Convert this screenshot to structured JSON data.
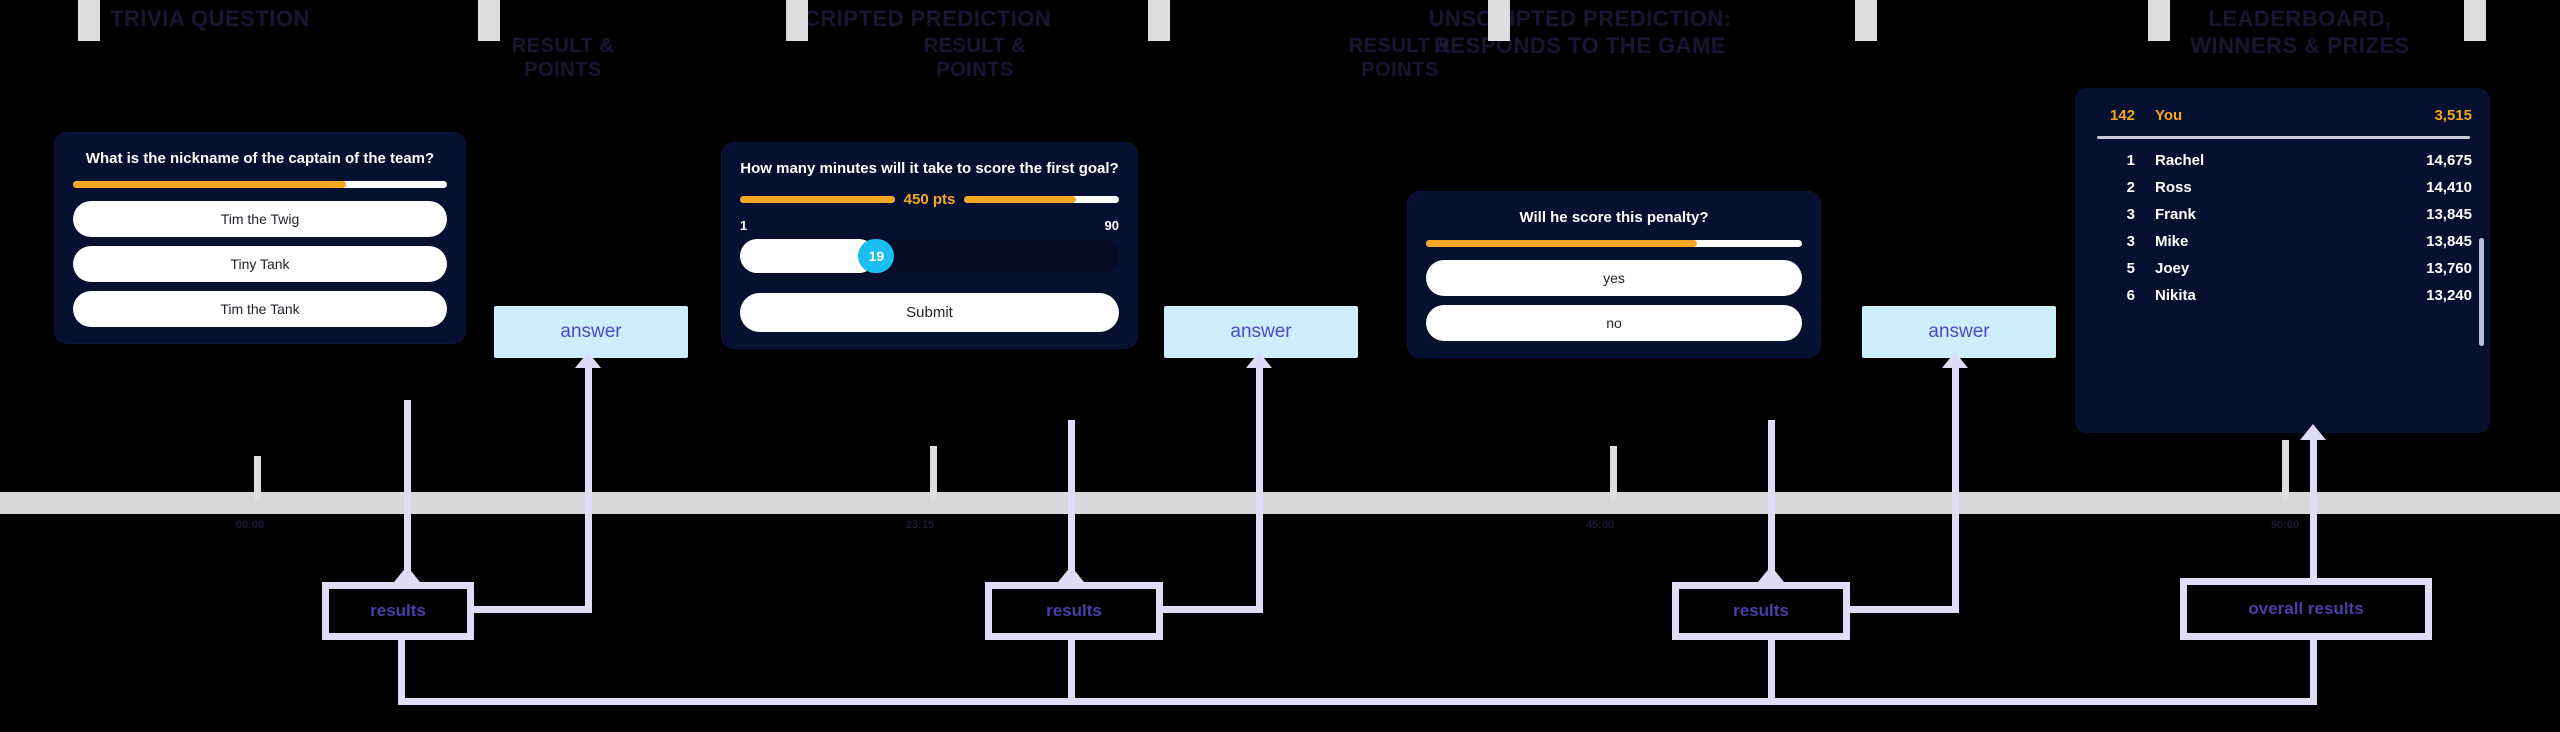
{
  "sections": [
    {
      "id": "trivia",
      "title": "TRIVIA QUESTION"
    },
    {
      "id": "result1",
      "title": "RESULT &\nPOINTS"
    },
    {
      "id": "scripted",
      "title": "SCRIPTED PREDICTION"
    },
    {
      "id": "result2",
      "title": "RESULT &\nPOINTS"
    },
    {
      "id": "unscripted",
      "title": "UNSCRIPTED PREDICTION:\nRESPONDS TO THE GAME"
    },
    {
      "id": "result3",
      "title": "RESULT &\nPOINTS"
    },
    {
      "id": "leaderboard",
      "title": "LEADERBOARD,\nWINNERS & PRIZES"
    }
  ],
  "cards": {
    "trivia": {
      "question": "What is the nickname of the captain of the team?",
      "progress_percent": 73,
      "options": [
        "Tim the Twig",
        "Tiny Tank",
        "Tim the Tank"
      ]
    },
    "scripted": {
      "question": "How many minutes will it take to score the first goal?",
      "points_label": "450 pts",
      "progress_left_percent": 100,
      "progress_right_percent": 72,
      "range_min": "1",
      "range_max": "90",
      "slider_value": "19",
      "slider_percent": 36,
      "submit_label": "Submit"
    },
    "unscripted": {
      "question": "Will he score this penalty?",
      "progress_percent": 72,
      "options": [
        "yes",
        "no"
      ]
    }
  },
  "leaderboard": {
    "you": {
      "rank": "142",
      "name": "You",
      "score": "3,515"
    },
    "rows": [
      {
        "rank": "1",
        "name": "Rachel",
        "score": "14,675"
      },
      {
        "rank": "2",
        "name": "Ross",
        "score": "14,410"
      },
      {
        "rank": "3",
        "name": "Frank",
        "score": "13,845"
      },
      {
        "rank": "3",
        "name": "Mike",
        "score": "13,845"
      },
      {
        "rank": "5",
        "name": "Joey",
        "score": "13,760"
      },
      {
        "rank": "6",
        "name": "Nikita",
        "score": "13,240"
      }
    ]
  },
  "answer_chips": [
    {
      "label": "answer"
    },
    {
      "label": "answer"
    },
    {
      "label": "answer"
    }
  ],
  "flow_boxes": [
    {
      "label": "results"
    },
    {
      "label": "results"
    },
    {
      "label": "results"
    },
    {
      "label": "overall results"
    }
  ],
  "timeline": {
    "labels": [
      "00:00",
      "23:15",
      "45:00",
      "90:00"
    ]
  },
  "colors": {
    "accent_orange": "#f5a623",
    "card_navy": "#061030",
    "knob_cyan": "#19bdf0",
    "flow_lavender": "#dedcf7",
    "answer_blue": "#cdeefc",
    "timeline_gray": "#d6d8da",
    "title_navy": "#181633"
  }
}
